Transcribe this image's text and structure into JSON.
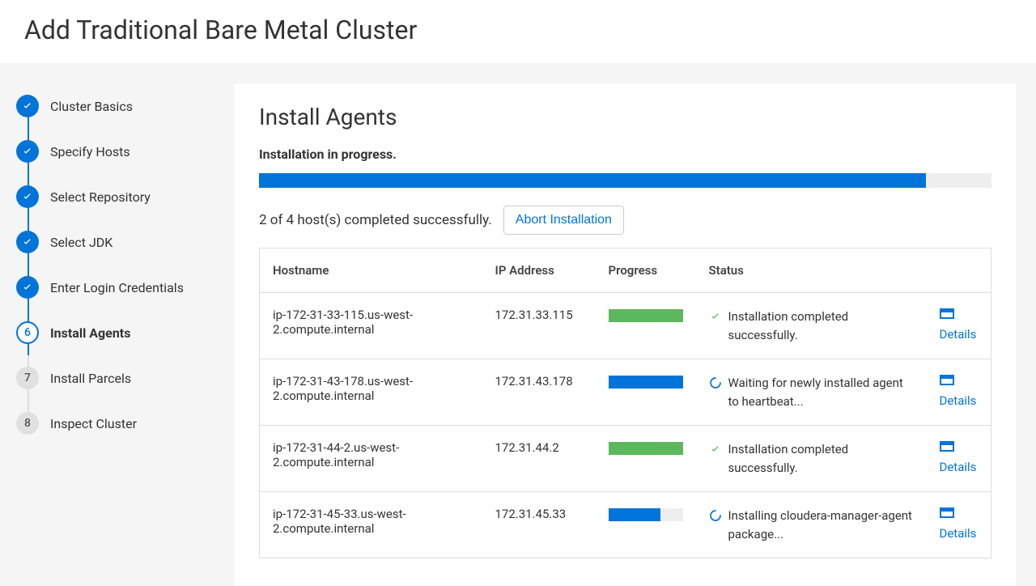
{
  "page_title": "Add Traditional Bare Metal Cluster",
  "steps": [
    {
      "label": "Cluster Basics",
      "state": "done"
    },
    {
      "label": "Specify Hosts",
      "state": "done"
    },
    {
      "label": "Select Repository",
      "state": "done"
    },
    {
      "label": "Select JDK",
      "state": "done"
    },
    {
      "label": "Enter Login Credentials",
      "state": "done"
    },
    {
      "label": "Install Agents",
      "state": "current",
      "num": "6"
    },
    {
      "label": "Install Parcels",
      "state": "future",
      "num": "7"
    },
    {
      "label": "Inspect Cluster",
      "state": "future",
      "num": "8"
    }
  ],
  "main": {
    "heading": "Install Agents",
    "sub_status": "Installation in progress.",
    "overall_progress_pct": 91,
    "summary": "2 of 4 host(s) completed successfully.",
    "abort_label": "Abort Installation",
    "columns": {
      "hostname": "Hostname",
      "ip": "IP Address",
      "progress": "Progress",
      "status": "Status"
    },
    "details_label": "Details",
    "rows": [
      {
        "hostname": "ip-172-31-33-115.us-west-2.compute.internal",
        "ip": "172.31.33.115",
        "progress_pct": 100,
        "progress_color": "green",
        "status_icon": "check",
        "status_text": "Installation completed successfully."
      },
      {
        "hostname": "ip-172-31-43-178.us-west-2.compute.internal",
        "ip": "172.31.43.178",
        "progress_pct": 100,
        "progress_color": "blue",
        "status_icon": "spinner",
        "status_text": "Waiting for newly installed agent to heartbeat..."
      },
      {
        "hostname": "ip-172-31-44-2.us-west-2.compute.internal",
        "ip": "172.31.44.2",
        "progress_pct": 100,
        "progress_color": "green",
        "status_icon": "check",
        "status_text": "Installation completed successfully."
      },
      {
        "hostname": "ip-172-31-45-33.us-west-2.compute.internal",
        "ip": "172.31.45.33",
        "progress_pct": 70,
        "progress_color": "blue",
        "status_icon": "spinner",
        "status_text": "Installing cloudera-manager-agent package..."
      }
    ]
  }
}
